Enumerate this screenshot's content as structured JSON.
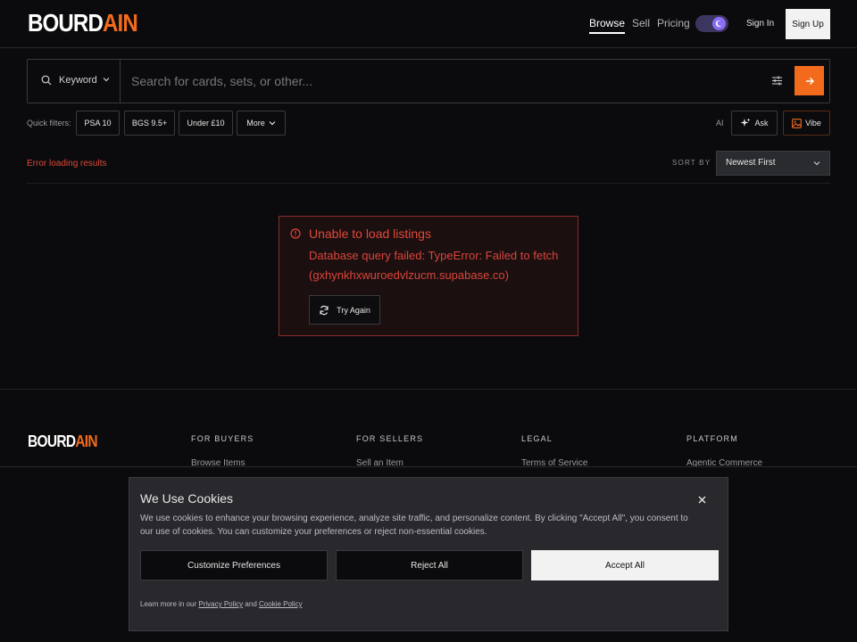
{
  "header": {
    "logo_main": "BOURD",
    "logo_ai": "AIN",
    "nav": [
      "Browse",
      "Sell",
      "Pricing"
    ],
    "sign_in": "Sign In",
    "sign_up": "Sign Up"
  },
  "search": {
    "mode": "Keyword",
    "placeholder": "Search for cards, sets, or other..."
  },
  "quick_filters": {
    "label": "Quick filters:",
    "chips": [
      "PSA 10",
      "BGS 9.5+",
      "Under £10",
      "More"
    ],
    "ai_label": "AI",
    "ask": "Ask",
    "vibe": "Vibe"
  },
  "results": {
    "status": "Error loading results",
    "sort_label": "SORT BY",
    "sort_value": "Newest First"
  },
  "error": {
    "title": "Unable to load listings",
    "message": "Database query failed: TypeError: Failed to fetch (gxhynkhxwuroedvlzucm.supabase.co)",
    "retry": "Try Again"
  },
  "footer": {
    "logo_main": "BOURD",
    "logo_ai": "AIN",
    "columns": [
      {
        "heading": "FOR BUYERS",
        "link": "Browse Items"
      },
      {
        "heading": "FOR SELLERS",
        "link": "Sell an Item"
      },
      {
        "heading": "LEGAL",
        "link": "Terms of Service"
      },
      {
        "heading": "PLATFORM",
        "link": "Agentic Commerce"
      }
    ]
  },
  "cookie": {
    "title": "We Use Cookies",
    "description": "We use cookies to enhance your browsing experience, analyze site traffic, and personalize content. By clicking \"Accept All\", you consent to our use of cookies. You can customize your preferences or reject non-essential cookies.",
    "customize": "Customize Preferences",
    "reject": "Reject All",
    "accept": "Accept All",
    "learn_prefix": "Learn more in our",
    "privacy": "Privacy Policy",
    "and": "and",
    "cookie_policy": "Cookie Policy"
  },
  "colors": {
    "accent": "#f26b1d",
    "error": "#e0483a",
    "background": "#0b0b0d"
  }
}
